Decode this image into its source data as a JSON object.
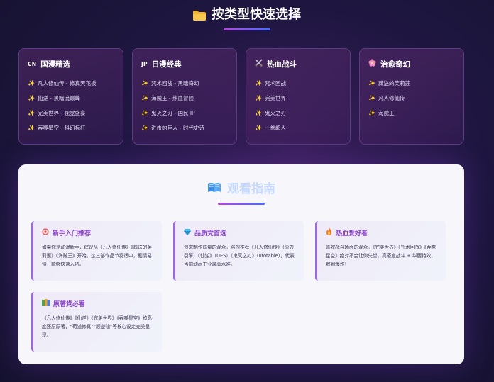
{
  "header": {
    "title": "按类型快速选择",
    "icon": "folder-icon"
  },
  "categories": [
    {
      "tag": "CN",
      "title": "国漫精选",
      "items": [
        "凡人修仙传 - 修真天花板",
        "仙逆 - 黑暗流巅峰",
        "完美世界 - 视觉盛宴",
        "吞噬星空 - 科幻标杆"
      ]
    },
    {
      "tag": "JP",
      "title": "日漫经典",
      "items": [
        "咒术回战 - 黑暗奇幻",
        "海贼王 - 热血冒险",
        "鬼灭之刃 - 国民 IP",
        "进击的巨人 - 时代史诗"
      ]
    },
    {
      "tag": "",
      "title": "热血战斗",
      "items": [
        "咒术回战",
        "完美世界",
        "鬼灭之刃",
        "一拳超人"
      ]
    },
    {
      "tag": "",
      "title": "治愈奇幻",
      "items": [
        "葬送的芙莉莲",
        "凡人修仙传",
        "海贼王"
      ]
    }
  ],
  "panel": {
    "title": "观看指南",
    "cards": [
      {
        "title": "新手入门推荐",
        "text": "如果你是动漫新手，建议从《凡人修仙传》《葬送的芙莉莲》《海贼王》开始，这三部作品节奏适中，剧情易懂，能够快速入坑。"
      },
      {
        "title": "品质党首选",
        "text": "追求制作质量的观众，强烈推荐《凡人修仙传》（原力引擎）《仙逆》（UES）《鬼灭之刃》（ufotable），代表当前动画工业最高水准。"
      },
      {
        "title": "热血爱好者",
        "text": "喜欢战斗场面的观众，《完美世界》《咒术回战》《吞噬星空》绝对不会让你失望，高密度战斗 + 华丽特效，燃到爆炸！"
      },
      {
        "title": "原著党必看",
        "text": "《凡人修仙传》《仙逆》《完美世界》《吞噬星空》均高度还原原著，“苟道修真”“顺逆仙”等核心设定完美呈现。"
      }
    ]
  },
  "colors": {
    "accent": "#8a44c8",
    "spark": "#f5c542",
    "bg": "#1e1640"
  }
}
